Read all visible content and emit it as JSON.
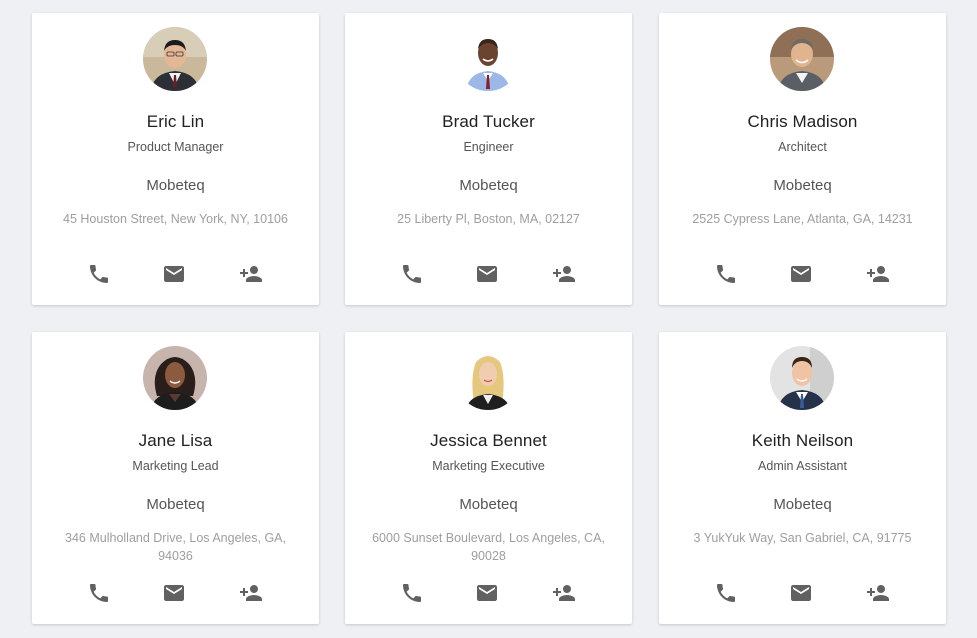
{
  "colors": {
    "background": "#eef0f3",
    "card": "#ffffff",
    "name_text": "#212121",
    "role_text": "#555555",
    "address_text": "#9e9e9e",
    "icon": "#616161"
  },
  "icons": {
    "phone": "phone-icon",
    "mail": "mail-icon",
    "add_contact": "person-add-icon"
  },
  "contacts": [
    {
      "name": "Eric Lin",
      "title": "Product Manager",
      "company": "Mobeteq",
      "address": "45 Houston Street, New York, NY, 10106"
    },
    {
      "name": "Brad Tucker",
      "title": "Engineer",
      "company": "Mobeteq",
      "address": "25 Liberty Pl, Boston, MA, 02127"
    },
    {
      "name": "Chris Madison",
      "title": "Architect",
      "company": "Mobeteq",
      "address": "2525 Cypress Lane, Atlanta, GA, 14231"
    },
    {
      "name": "Jane Lisa",
      "title": "Marketing Lead",
      "company": "Mobeteq",
      "address": "346 Mulholland Drive, Los Angeles, GA, 94036"
    },
    {
      "name": "Jessica Bennet",
      "title": "Marketing Executive",
      "company": "Mobeteq",
      "address": "6000 Sunset Boulevard, Los Angeles, CA, 90028"
    },
    {
      "name": "Keith Neilson",
      "title": "Admin Assistant",
      "company": "Mobeteq",
      "address": "3 YukYuk Way, San Gabriel, CA, 91775"
    }
  ]
}
